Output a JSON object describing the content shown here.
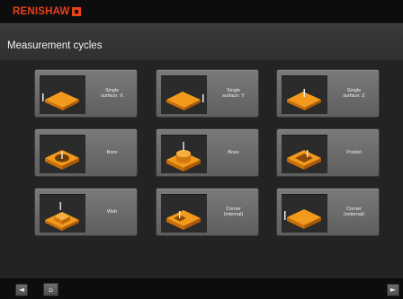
{
  "brand": {
    "name": "RENISHAW",
    "color": "#e8411a"
  },
  "header": {
    "title": "Measurement cycles"
  },
  "colors": {
    "part": "#f39a1c",
    "part_dark": "#c96f0a",
    "probe": "#eeeeee"
  },
  "cycles": [
    {
      "label": "Single\nsurface: X",
      "icon": "surface-x-icon"
    },
    {
      "label": "Single\nsurface: Y",
      "icon": "surface-y-icon"
    },
    {
      "label": "Single\nsurface: Z",
      "icon": "surface-z-icon"
    },
    {
      "label": "Bore",
      "icon": "bore-icon"
    },
    {
      "label": "Boss",
      "icon": "boss-icon"
    },
    {
      "label": "Pocket",
      "icon": "pocket-icon"
    },
    {
      "label": "Web",
      "icon": "web-icon"
    },
    {
      "label": "Corner\n(internal)",
      "icon": "corner-internal-icon"
    },
    {
      "label": "Corner\n(external)",
      "icon": "corner-external-icon"
    }
  ],
  "footer": {
    "back_glyph": "◄",
    "home_glyph": "⌂",
    "forward_glyph": "►"
  }
}
